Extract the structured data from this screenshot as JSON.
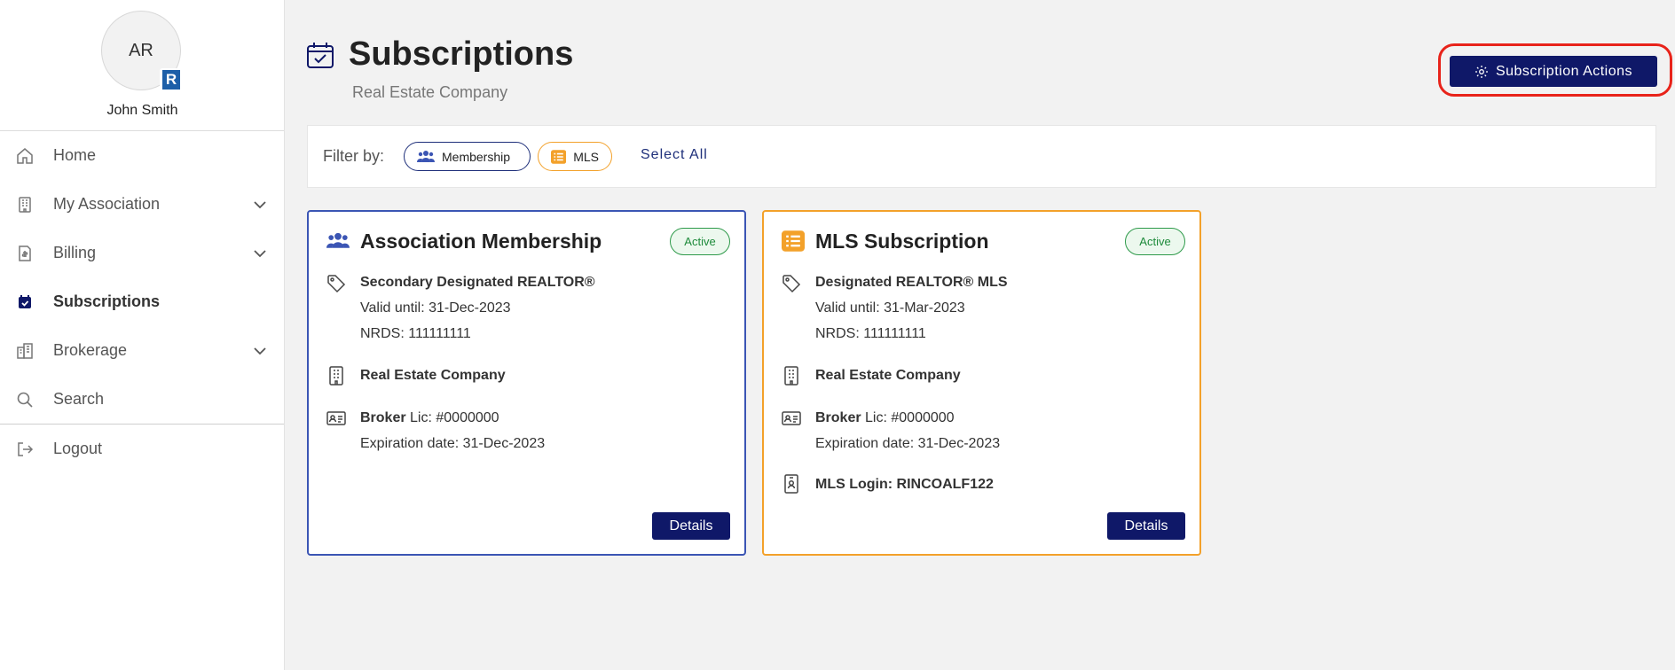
{
  "profile": {
    "initials": "AR",
    "name": "John Smith"
  },
  "nav": {
    "home": "Home",
    "association": "My Association",
    "billing": "Billing",
    "subscriptions": "Subscriptions",
    "brokerage": "Brokerage",
    "search": "Search",
    "logout": "Logout"
  },
  "header": {
    "title": "Subscriptions",
    "subtitle": "Real Estate Company",
    "actions_label": "Subscription Actions"
  },
  "filter": {
    "label": "Filter by:",
    "chips": [
      {
        "label": "Membership"
      },
      {
        "label": "MLS"
      }
    ],
    "select_all": "Select All"
  },
  "cards": [
    {
      "title": "Association Membership",
      "status": "Active",
      "designation": "Secondary Designated REALTOR®",
      "valid_until": "Valid until: 31-Dec-2023",
      "nrds": "NRDS: 111111111",
      "company": "Real Estate Company",
      "license_role": "Broker",
      "license_number": " Lic: #0000000",
      "expiration": "Expiration date: 31-Dec-2023",
      "details_label": "Details"
    },
    {
      "title": "MLS Subscription",
      "status": "Active",
      "designation": "Designated REALTOR® MLS",
      "valid_until": "Valid until: 31-Mar-2023",
      "nrds": "NRDS: 111111111",
      "company": "Real Estate Company",
      "license_role": "Broker",
      "license_number": " Lic: #0000000",
      "expiration": "Expiration date: 31-Dec-2023",
      "mls_login": "MLS Login: RINCOALF122",
      "details_label": "Details"
    }
  ],
  "colors": {
    "primary": "#0f1868",
    "membership_border": "#3b55b4",
    "mls_border": "#f3a12a",
    "active_green": "#2e9a4a",
    "highlight_ring": "#e8231a"
  },
  "icons": {
    "page": "calendar-check-icon",
    "membership": "users-icon",
    "mls": "list-icon",
    "tag": "tag-icon",
    "building": "building-icon",
    "license": "id-card-icon",
    "login": "badge-icon",
    "actions": "gear-icon"
  }
}
